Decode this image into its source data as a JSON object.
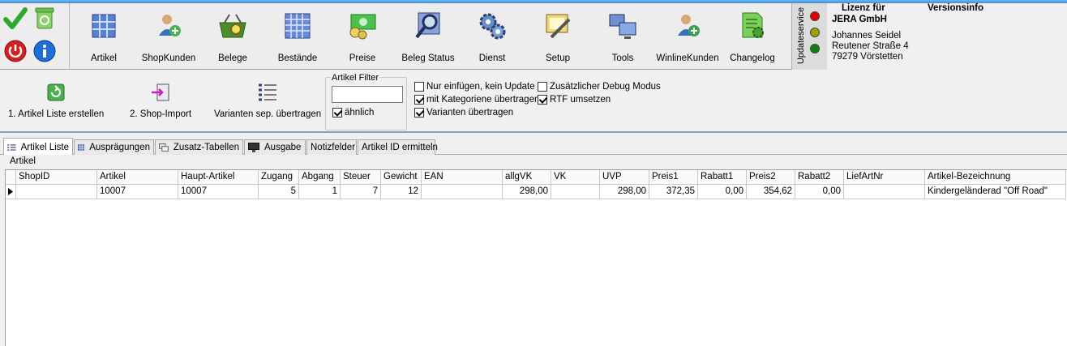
{
  "toolbar": {
    "buttons": [
      {
        "label": "Artikel",
        "icon": "grid-icon"
      },
      {
        "label": "ShopKunden",
        "icon": "user-cycle-icon"
      },
      {
        "label": "Belege",
        "icon": "basket-icon"
      },
      {
        "label": "Bestände",
        "icon": "stock-grid-icon"
      },
      {
        "label": "Preise",
        "icon": "money-icon"
      },
      {
        "label": "Beleg Status",
        "icon": "magnifier-icon"
      },
      {
        "label": "Dienst",
        "icon": "gears-icon"
      },
      {
        "label": "Setup",
        "icon": "setup-icon"
      },
      {
        "label": "Tools",
        "icon": "monitors-icon"
      },
      {
        "label": "WinlineKunden",
        "icon": "user-sync-icon"
      },
      {
        "label": "Changelog",
        "icon": "document-gear-icon"
      }
    ]
  },
  "updateservice": {
    "label": "Updateservice",
    "leds": [
      "#e00000",
      "#a0a000",
      "#108010"
    ]
  },
  "license": {
    "tab1": "Lizenz für",
    "tab2": "Versionsinfo",
    "company": "JERA GmbH",
    "name": "Johannes Seidel",
    "street": "Reutener Straße 4",
    "city": "79279 Vörstetten"
  },
  "sub": {
    "btn1": "1. Artikel Liste erstellen",
    "btn2": "2. Shop-Import",
    "btn3": "Varianten sep. übertragen",
    "filter_title": "Artikel Filter",
    "filter_value": "",
    "similar": "ähnlich",
    "opt1": "Nur einfügen, kein Update",
    "opt2": "mit Kategoriene übertragen",
    "opt3": "Varianten übertragen",
    "opt4": "Zusätzlicher Debug Modus",
    "opt5": "RTF umsetzen"
  },
  "tabs": [
    "Artikel Liste",
    "Ausprägungen",
    "Zusatz-Tabellen",
    "Ausgabe",
    "Notizfelder",
    "Artikel ID ermitteln"
  ],
  "panel_label": "Artikel",
  "columns": [
    "ShopID",
    "Artikel",
    "Haupt-Artikel",
    "Zugang",
    "Abgang",
    "Steuer",
    "Gewicht",
    "EAN",
    "allgVK",
    "VK",
    "UVP",
    "Preis1",
    "Rabatt1",
    "Preis2",
    "Rabatt2",
    "LiefArtNr",
    "Artikel-Bezeichnung"
  ],
  "rows": [
    [
      "",
      "10007",
      "10007",
      "5",
      "1",
      "7",
      "12",
      "",
      "298,00",
      "",
      "298,00",
      "372,35",
      "0,00",
      "354,62",
      "0,00",
      "",
      "Kindergeländerad \"Off Road\""
    ]
  ]
}
